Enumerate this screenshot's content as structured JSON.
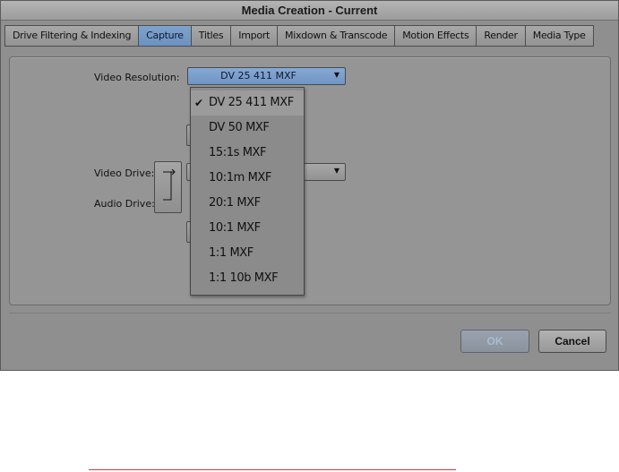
{
  "window": {
    "title": "Media Creation - Current"
  },
  "tabs": [
    {
      "label": "Drive Filtering & Indexing",
      "active": false
    },
    {
      "label": "Capture",
      "active": true
    },
    {
      "label": "Titles",
      "active": false
    },
    {
      "label": "Import",
      "active": false
    },
    {
      "label": "Mixdown & Transcode",
      "active": false
    },
    {
      "label": "Motion Effects",
      "active": false
    },
    {
      "label": "Render",
      "active": false
    },
    {
      "label": "Media Type",
      "active": false
    }
  ],
  "capture": {
    "video_resolution_label": "Video Resolution:",
    "video_resolution_value": "DV 25 411  MXF",
    "video_drive_label": "Video Drive:",
    "audio_drive_label": "Audio Drive:"
  },
  "dropdown": {
    "options": [
      "DV 25 411  MXF",
      "DV 50  MXF",
      "15:1s  MXF",
      "10:1m  MXF",
      "20:1  MXF",
      "10:1  MXF",
      "1:1  MXF",
      "1:1 10b  MXF"
    ],
    "selected_index": 0
  },
  "buttons": {
    "ok_label": "OK",
    "cancel_label": "Cancel"
  },
  "colors": {
    "active_tab": "#6b92c1",
    "panel": "#959595",
    "window": "#8f8f8f"
  }
}
